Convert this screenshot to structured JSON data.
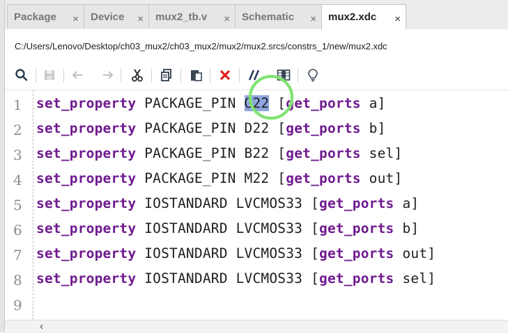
{
  "tabs": [
    {
      "label": "Package",
      "active": false
    },
    {
      "label": "Device",
      "active": false
    },
    {
      "label": "mux2_tb.v",
      "active": false
    },
    {
      "label": "Schematic",
      "active": false
    },
    {
      "label": "mux2.xdc",
      "active": true
    }
  ],
  "tab_close_glyph": "×",
  "file_path": "C:/Users/Lenovo/Desktop/ch03_mux2/ch03_mux2/mux2/mux2.srcs/constrs_1/new/mux2.xdc",
  "toolbar_icons": [
    "search-icon",
    "save-icon",
    "undo-icon",
    "redo-icon",
    "cut-icon",
    "copy-icon",
    "paste-icon",
    "delete-icon",
    "comment-toggle-icon",
    "columns-icon",
    "lightbulb-icon"
  ],
  "editor": {
    "lines": [
      {
        "num": "1",
        "cmd": "set_property",
        "prop": "PACKAGE_PIN",
        "value": "G22",
        "sub": "get_ports",
        "port": "a",
        "selected": true
      },
      {
        "num": "2",
        "cmd": "set_property",
        "prop": "PACKAGE_PIN",
        "value": "D22",
        "sub": "get_ports",
        "port": "b"
      },
      {
        "num": "3",
        "cmd": "set_property",
        "prop": "PACKAGE_PIN",
        "value": "B22",
        "sub": "get_ports",
        "port": "sel"
      },
      {
        "num": "4",
        "cmd": "set_property",
        "prop": "PACKAGE_PIN",
        "value": "M22",
        "sub": "get_ports",
        "port": "out"
      },
      {
        "num": "5",
        "cmd": "set_property",
        "prop": "IOSTANDARD",
        "value": "LVCMOS33",
        "sub": "get_ports",
        "port": "a"
      },
      {
        "num": "6",
        "cmd": "set_property",
        "prop": "IOSTANDARD",
        "value": "LVCMOS33",
        "sub": "get_ports",
        "port": "b"
      },
      {
        "num": "7",
        "cmd": "set_property",
        "prop": "IOSTANDARD",
        "value": "LVCMOS33",
        "sub": "get_ports",
        "port": "out"
      },
      {
        "num": "8",
        "cmd": "set_property",
        "prop": "IOSTANDARD",
        "value": "LVCMOS33",
        "sub": "get_ports",
        "port": "sel"
      },
      {
        "num": "9"
      }
    ]
  },
  "colors": {
    "keyword": "#6f1a8f",
    "selection": "#8ea6e0",
    "highlight_ring": "#7ee36f"
  }
}
